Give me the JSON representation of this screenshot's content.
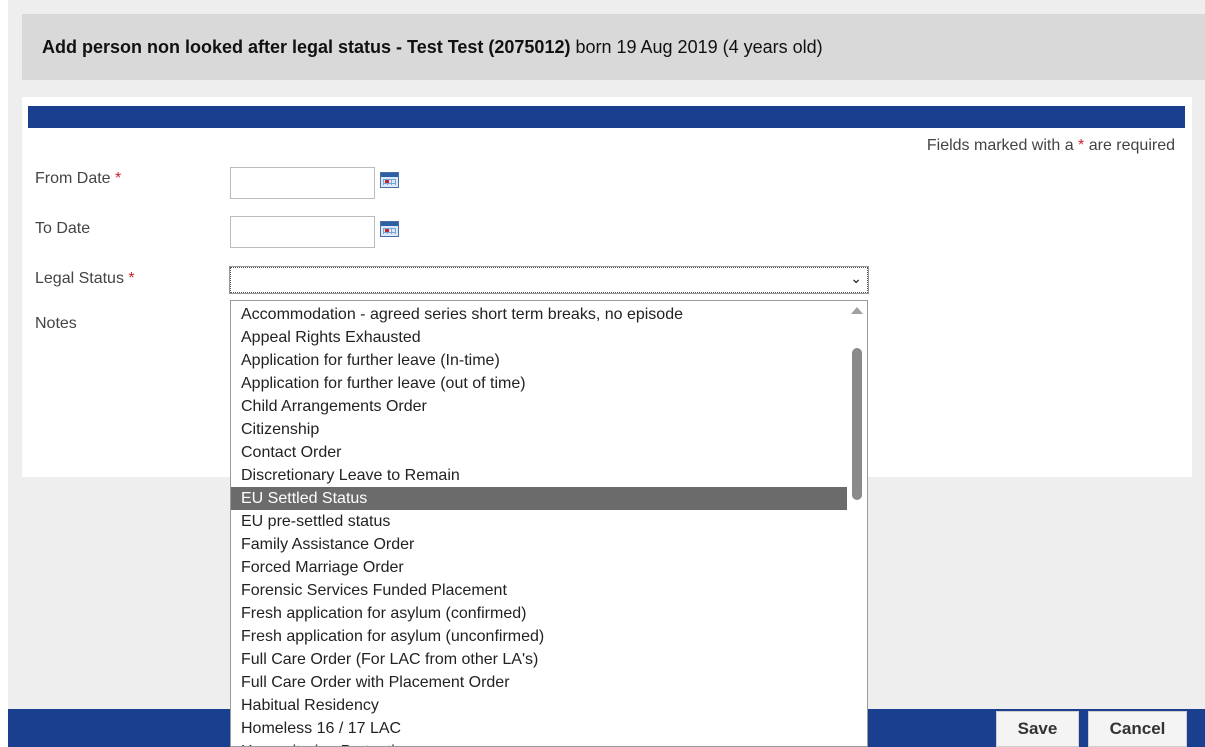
{
  "header": {
    "title_bold": "Add person non looked after legal status - Test Test (2075012)",
    "title_rest": " born 19 Aug 2019 (4 years old)"
  },
  "form": {
    "required_note_prefix": "Fields marked with a ",
    "required_star": "*",
    "required_note_suffix": " are required",
    "from_date_label": "From Date",
    "to_date_label": "To Date",
    "legal_status_label": "Legal Status",
    "notes_label": "Notes",
    "from_date_value": "",
    "to_date_value": "",
    "legal_status_value": ""
  },
  "dropdown": {
    "selected_index": 8,
    "options": [
      "Accommodation - agreed series short term breaks, no episode",
      "Appeal Rights Exhausted",
      "Application for further leave (In-time)",
      "Application for further leave (out of time)",
      "Child Arrangements Order",
      "Citizenship",
      "Contact Order",
      "Discretionary Leave to Remain",
      "EU Settled Status",
      "EU pre-settled status",
      "Family Assistance Order",
      "Forced Marriage Order",
      "Forensic Services Funded Placement",
      "Fresh application for asylum (confirmed)",
      "Fresh application for asylum (unconfirmed)",
      "Full Care Order (For LAC from other LA's)",
      "Full Care Order with Placement Order",
      "Habitual Residency",
      "Homeless 16 / 17 LAC",
      "Humanitarian Protection"
    ]
  },
  "footer": {
    "save_label": "Save",
    "cancel_label": "Cancel"
  },
  "colors": {
    "accent_blue": "#1b3f8f",
    "required_red": "#d0202e",
    "selected_option_bg": "#6b6b6b"
  }
}
